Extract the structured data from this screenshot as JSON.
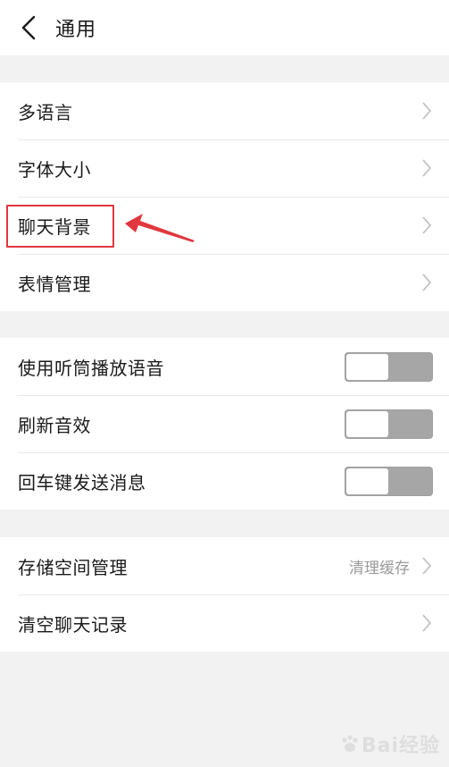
{
  "header": {
    "title": "通用"
  },
  "group1": {
    "items": [
      {
        "label": "多语言"
      },
      {
        "label": "字体大小"
      },
      {
        "label": "聊天背景"
      },
      {
        "label": "表情管理"
      }
    ]
  },
  "group2": {
    "items": [
      {
        "label": "使用听筒播放语音",
        "on": false
      },
      {
        "label": "刷新音效",
        "on": false
      },
      {
        "label": "回车键发送消息",
        "on": false
      }
    ]
  },
  "group3": {
    "items": [
      {
        "label": "存储空间管理",
        "sub": "清理缓存"
      },
      {
        "label": "清空聊天记录"
      }
    ]
  },
  "annotation": {
    "color": "#e0383e"
  },
  "watermark": {
    "text": "Bai经验"
  },
  "colors": {
    "background": "#f2f2f2",
    "card": "#ffffff",
    "toggle_off": "#a6a6a6",
    "secondary_text": "#9a9a9a"
  }
}
